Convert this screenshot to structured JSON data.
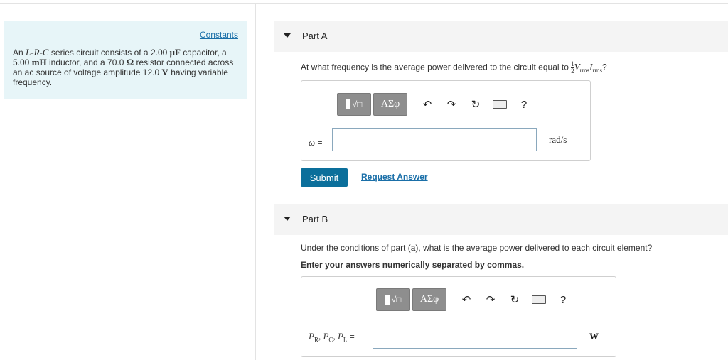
{
  "constants": {
    "link": "Constants",
    "t1": "An ",
    "v_L": "L",
    "d1": "-",
    "v_R": "R",
    "d2": "-",
    "v_C": "C",
    "t2": " series circuit consists of a 2.00 ",
    "u_muF": "μF",
    "t3": " capacitor, a 5.00 ",
    "u_mH": "mH",
    "t4": " inductor, and a 70.0 ",
    "u_ohm": "Ω",
    "t5": " resistor connected across an ac source of voltage amplitude 12.0 ",
    "u_V": "V",
    "t6": " having variable frequency."
  },
  "part_a": {
    "title": "Part A",
    "question_prefix": "At what frequency is the average power delivered to the circuit equal to ",
    "frac_num": "1",
    "frac_den": "2",
    "v1": "V",
    "v1_sub": "rms",
    "v2": "I",
    "v2_sub": "rms",
    "question_suffix": "?",
    "var_omega": "ω",
    "var_eq": " =",
    "unit": "rad/s"
  },
  "toolbar": {
    "templates_glyph": "√□",
    "greek_label": "ΑΣφ",
    "undo": "↶",
    "redo": "↷",
    "reset": "↻",
    "help": "?"
  },
  "actions": {
    "submit": "Submit",
    "request_answer": "Request Answer"
  },
  "part_b": {
    "title": "Part B",
    "question": "Under the conditions of part (a), what is the average power delivered to each circuit element?",
    "instruction": "Enter your answers numerically separated by commas.",
    "P1": "P",
    "P1_sub": "R",
    "comma1": ", ",
    "P2": "P",
    "P2_sub": "C",
    "comma2": ", ",
    "P3": "P",
    "P3_sub": "L",
    "var_eq": " =",
    "unit": "W"
  }
}
